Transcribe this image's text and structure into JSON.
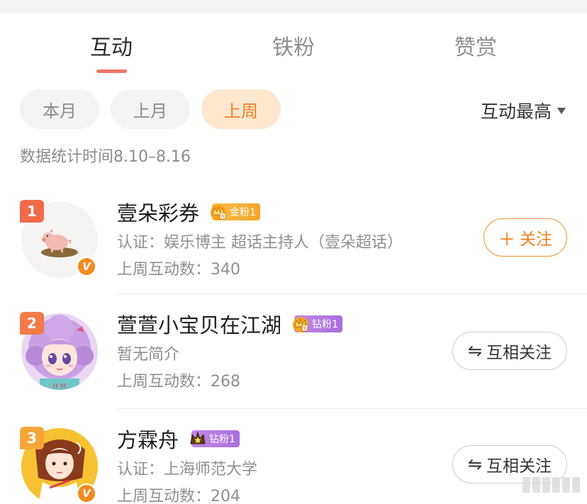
{
  "tabs": [
    "互动",
    "铁粉",
    "赞赏"
  ],
  "filters": {
    "chips": [
      "本月",
      "上月",
      "上周"
    ],
    "sort_label": "互动最高"
  },
  "stat_time": "数据统计时间8.10–8.16",
  "colors": {
    "accent": "#f07f1f",
    "tab_underline": "#f0776a",
    "rank": "#f16a4a",
    "gold_badge": "#f6b93b",
    "diamond_badge": "#b77ee6"
  },
  "fans": [
    {
      "rank": "1",
      "name": "壹朵彩券",
      "badge": "金粉1",
      "badge_tier": "gold",
      "desc": "认证：娱乐博主 超话主持人（壹朵超话）",
      "count": "上周互动数：340",
      "button": "关注",
      "button_icon": "plus-icon",
      "verified": "V"
    },
    {
      "rank": "2",
      "name": "萱萱小宝贝在江湖",
      "badge": "钻粉1",
      "badge_tier": "diamond",
      "desc": "暂无简介",
      "count": "上周互动数：268",
      "button": "互相关注",
      "button_icon": "mutual-arrows-icon"
    },
    {
      "rank": "3",
      "name": "方霖舟",
      "badge": "钻粉1",
      "badge_tier": "diamond",
      "desc": "认证：上海师范大学",
      "count": "上周互动数：204",
      "button": "互相关注",
      "button_icon": "mutual-arrows-icon",
      "verified": "V"
    }
  ]
}
